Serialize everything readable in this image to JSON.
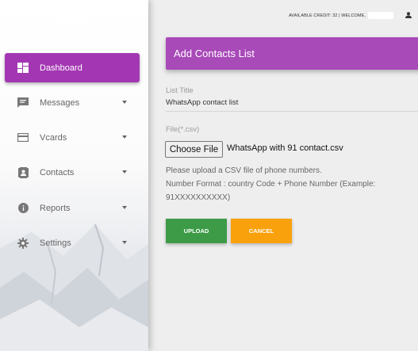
{
  "header": {
    "credit_text": "AVAILABLE CREDIT: 32 | WELCOME,"
  },
  "sidebar": {
    "items": [
      {
        "label": "Dashboard",
        "icon": "dashboard-icon",
        "active": true
      },
      {
        "label": "Messages",
        "icon": "message-icon"
      },
      {
        "label": "Vcards",
        "icon": "card-icon"
      },
      {
        "label": "Contacts",
        "icon": "contacts-icon"
      },
      {
        "label": "Reports",
        "icon": "info-icon"
      },
      {
        "label": "Settings",
        "icon": "gear-icon"
      }
    ]
  },
  "form": {
    "title": "Add Contacts List",
    "list_title_label": "List Title",
    "list_title_value": "WhatsApp contact list",
    "file_label": "File(*.csv)",
    "choose_file_label": "Choose File",
    "file_name": "WhatsApp with 91 contact.csv",
    "help_line1": "Please upload a CSV file of phone numbers.",
    "help_line2": "Number Format : country Code + Phone Number (Example:",
    "help_line3": "91XXXXXXXXXX)",
    "upload_label": "UPLOAD",
    "cancel_label": "CANCEL"
  },
  "colors": {
    "accent": "#a94ab9",
    "upload": "#3d9b47",
    "cancel": "#f9a10d"
  }
}
